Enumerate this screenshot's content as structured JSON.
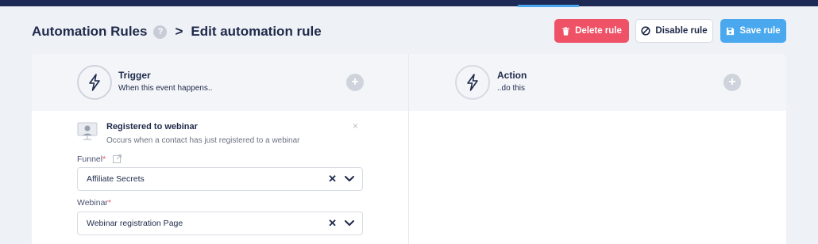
{
  "header": {
    "breadcrumb_root": "Automation Rules",
    "help": "?",
    "separator": ">",
    "page_title": "Edit automation rule"
  },
  "actions": {
    "delete_label": "Delete rule",
    "disable_label": "Disable rule",
    "save_label": "Save rule"
  },
  "trigger": {
    "title": "Trigger",
    "subtitle": "When this event happens..",
    "add": "+"
  },
  "action": {
    "title": "Action",
    "subtitle": "..do this",
    "add": "+"
  },
  "event": {
    "title": "Registered to webinar",
    "description": "Occurs when a contact has just registered to a webinar",
    "close": "×"
  },
  "fields": {
    "funnel": {
      "label": "Funnel",
      "required": "*",
      "value": "Affiliate Secrets",
      "clear": "✕"
    },
    "webinar": {
      "label": "Webinar",
      "required": "*",
      "value": "Webinar registration Page",
      "clear": "✕"
    }
  },
  "colors": {
    "nav": "#1c2a55",
    "accent": "#4aa8ef",
    "danger": "#ef5267",
    "text": "#1f2a4a"
  }
}
